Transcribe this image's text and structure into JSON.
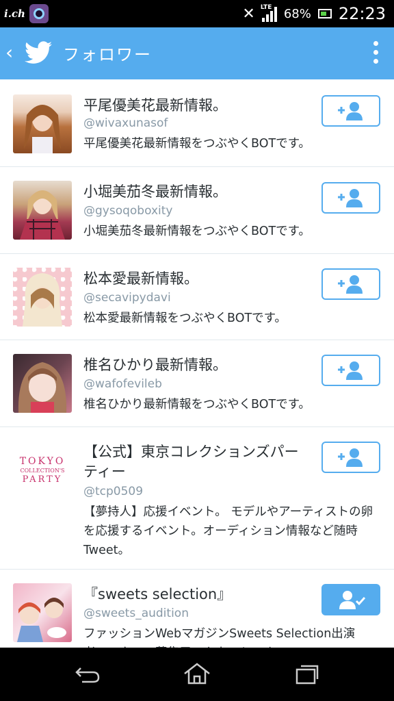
{
  "status_bar": {
    "carrier": "i.ch",
    "network": "LTE",
    "battery": "68%",
    "time": "22:23"
  },
  "app_bar": {
    "back_icon": "chevron-left-icon",
    "logo_icon": "twitter-bird-icon",
    "title": "フォロワー",
    "menu_icon": "overflow-menu-icon"
  },
  "followers": [
    {
      "name": "平尾優美花最新情報。",
      "handle": "@wivaxunasof",
      "bio": "平尾優美花最新情報をつぶやくBOTです。",
      "following": false
    },
    {
      "name": "小堀美茄冬最新情報。",
      "handle": "@gysoqoboxity",
      "bio": "小堀美茄冬最新情報をつぶやくBOTです。",
      "following": false
    },
    {
      "name": "松本愛最新情報。",
      "handle": "@secavipydavi",
      "bio": "松本愛最新情報をつぶやくBOTです。",
      "following": false
    },
    {
      "name": "椎名ひかり最新情報。",
      "handle": "@wafofevileb",
      "bio": "椎名ひかり最新情報をつぶやくBOTです。",
      "following": false
    },
    {
      "name": "【公式】東京コレクションズパーティー",
      "handle": "@tcp0509",
      "bio": "【夢持人】応援イベント。 モデルやアーティストの卵を応援するイベント。オーディション情報など随時Tweet。",
      "following": false,
      "avatar_text_1": "TOKYO",
      "avatar_text_2": "COLLECTION'S",
      "avatar_text_3": "PARTY"
    },
    {
      "name": "『sweets selection』",
      "handle": "@sweets_audition",
      "bio": "ファッションWebマガジンSweets Selection出演者・スタッフ募集用アカウントです。",
      "following": true
    }
  ],
  "nav_bar": {
    "back_icon": "back-arrow-icon",
    "home_icon": "home-icon",
    "recents_icon": "recent-apps-icon"
  },
  "colors": {
    "accent": "#55acee",
    "status_bar": "#000000",
    "text": "#292f33",
    "secondary_text": "#8899a6"
  }
}
